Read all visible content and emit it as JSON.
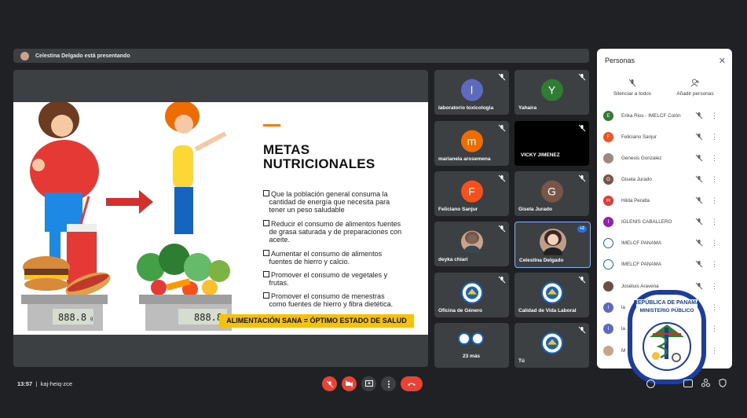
{
  "presenter_bar": {
    "text": "Celestina Delgado está presentando"
  },
  "slide": {
    "title_line1": "METAS",
    "title_line2": "NUTRICIONALES",
    "bullets": [
      {
        "l1": "Que la población general consuma la",
        "l2": "cantidad de energía que necesita para",
        "l3": "tener un peso saludable"
      },
      {
        "l1": "Reducir el consumo de alimentos fuentes",
        "l2": "de grasa saturada y de preparaciones con",
        "l3": "aceite."
      },
      {
        "l1": "Aumentar el consumo de alimentos",
        "l2": "fuentes de hierro y calcio.",
        "l3": ""
      },
      {
        "l1": "Promover el consumo de vegetales y",
        "l2": "frutas.",
        "l3": ""
      },
      {
        "l1": "Promover el consumo de menestras",
        "l2": "como fuentes de hierro y fibra dietética.",
        "l3": ""
      }
    ],
    "banner": "ALIMENTACIÓN SANA = ÓPTIMO ESTADO DE SALUD",
    "scale_left": "888.8",
    "scale_left_unit": "g",
    "scale_right": "888.8"
  },
  "tiles": [
    {
      "name": "laboratorio toxicologia",
      "initial": "l",
      "color": "#5c6bc0"
    },
    {
      "name": "Yahaira",
      "initial": "Y",
      "color": "#2e7d32"
    },
    {
      "name": "marianela arosemena",
      "initial": "m",
      "color": "#ef6c00"
    },
    {
      "name": "VICKY JIMENEZ",
      "initial": "",
      "color": "#000000"
    },
    {
      "name": "Feliciano Sanjur",
      "initial": "F",
      "color": "#f4511e"
    },
    {
      "name": "Gisela Jurado",
      "initial": "G",
      "color": "#795548"
    },
    {
      "name": "deyka chiari",
      "initial": "",
      "color": "#c8a48c"
    },
    {
      "name": "Celestina Delgado",
      "initial": "",
      "color": "#c8a48c"
    },
    {
      "name": "Oficina de Género",
      "initial": "",
      "color": "#ffffff"
    },
    {
      "name": "Calidad de Vida Laboral",
      "initial": "",
      "color": "#ffffff"
    },
    {
      "name": "23 más",
      "initial": "",
      "color": "#ffffff"
    },
    {
      "name": "Tú",
      "initial": "",
      "color": "#ffffff"
    }
  ],
  "active_badge": "+2",
  "panel": {
    "title": "Personas",
    "mute_all": "Silenciar a todos",
    "add_people": "Añadir personas",
    "people": [
      {
        "name": "Erika Rios - IMELCF Colón",
        "initial": "E",
        "color": "#2e7d32"
      },
      {
        "name": "Feliciano Sanjur",
        "initial": "F",
        "color": "#f4511e"
      },
      {
        "name": "Genesis Gonzalez",
        "initial": "",
        "color": "#a1887f"
      },
      {
        "name": "Gisela Jurado",
        "initial": "G",
        "color": "#795548"
      },
      {
        "name": "Hilda Peralta",
        "initial": "H",
        "color": "#e53935"
      },
      {
        "name": "IGLENIS CABALLERO",
        "initial": "I",
        "color": "#8e24aa"
      },
      {
        "name": "IMELCF PANAMA",
        "initial": "",
        "color": "#ffffff"
      },
      {
        "name": "IMELCF PANAMA",
        "initial": "",
        "color": "#ffffff"
      },
      {
        "name": "Joséluis Aravena",
        "initial": "",
        "color": "#6d4c41"
      },
      {
        "name": "la",
        "initial": "l",
        "color": "#5c6bc0"
      },
      {
        "name": "la",
        "initial": "l",
        "color": "#5c6bc0"
      },
      {
        "name": "M",
        "initial": "",
        "color": "#c8a48c"
      }
    ]
  },
  "bottom": {
    "time": "13:57",
    "separator": "|",
    "meeting_code": "kaj-heiq-zce"
  },
  "seal": {
    "line1": "REPÚBLICA DE PANAMÁ",
    "line2": "MINISTERIO PÚBLICO",
    "ring": "INSTITUTO DE MEDICINA LEGAL Y CIENCIAS FORENSES"
  }
}
